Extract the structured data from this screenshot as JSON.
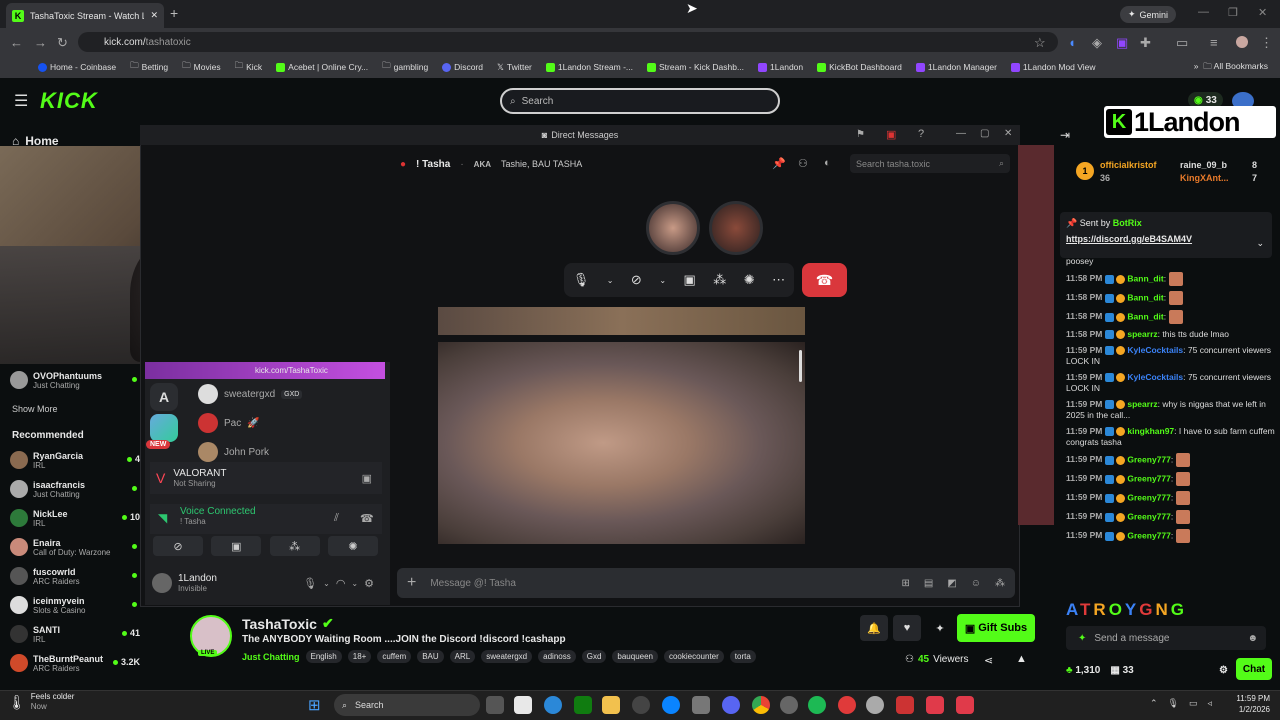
{
  "browser": {
    "tab_title": "TashaToxic Stream - Watch Live",
    "gemini": "Gemini",
    "url_host": "kick.com/",
    "url_path": "tashatoxic",
    "bookmarks": [
      "Home - Coinbase",
      "Betting",
      "Movies",
      "Kick",
      "Acebet | Online Cry...",
      "gambling",
      "Discord",
      "Twitter",
      "1Landon Stream -...",
      "Stream - Kick Dashb...",
      "1Landon",
      "KickBot Dashboard",
      "1Landon Manager",
      "1Landon Mod View"
    ],
    "all_bookmarks": "All Bookmarks"
  },
  "kick": {
    "search_placeholder": "Search",
    "home": "Home",
    "viewer_count": "33",
    "brand_name": "1Landon",
    "show_more": "Show More",
    "recommended": "Recommended",
    "following": [
      {
        "name": "OVOPhantuums",
        "sub": "Just Chatting",
        "count": ""
      }
    ],
    "recommended_list": [
      {
        "name": "RyanGarcia",
        "sub": "IRL",
        "count": "4",
        "color": "#8a6a50"
      },
      {
        "name": "isaacfrancis",
        "sub": "Just Chatting",
        "count": "",
        "color": "#aaa"
      },
      {
        "name": "NickLee",
        "sub": "IRL",
        "count": "10",
        "color": "#2d7a3a"
      },
      {
        "name": "Enaira",
        "sub": "Call of Duty: Warzone",
        "count": "",
        "color": "#c98a7a"
      },
      {
        "name": "fuscowrld",
        "sub": "ARC Raiders",
        "count": "",
        "color": "#555"
      },
      {
        "name": "iceinmyvein",
        "sub": "Slots & Casino",
        "count": "",
        "color": "#ddd"
      },
      {
        "name": "SANTI",
        "sub": "IRL",
        "count": "41",
        "color": "#333"
      },
      {
        "name": "TheBurntPeanut",
        "sub": "ARC Raiders",
        "count": "3.2K",
        "color": "#d04a2a"
      }
    ]
  },
  "discord": {
    "window_title": "Direct Messages",
    "dm_name": "! Tasha",
    "aka_label": "AKA",
    "aka_names": "Tashie, BAU TASHA",
    "search_placeholder": "Search tasha.toxic",
    "strip_link": "kick.com/TashaToxic",
    "new_badge": "NEW",
    "voice_users": [
      {
        "name": "sweatergxd",
        "tag": "GXD"
      },
      {
        "name": "Pac",
        "tag": ""
      },
      {
        "name": "John Pork",
        "tag": ""
      }
    ],
    "game": "VALORANT",
    "game_sub": "Not Sharing",
    "voice_connected": "Voice Connected",
    "voice_channel": "! Tasha",
    "user_name": "1Landon",
    "user_status": "Invisible",
    "message_placeholder": "Message @! Tasha"
  },
  "chat": {
    "leaders": [
      {
        "name": "officialkristof",
        "value": "36",
        "color": "#f5a623"
      },
      {
        "name": "raine_09_b",
        "value": "8",
        "color": "#ddd"
      },
      {
        "name": "KingXAnt...",
        "value": "7",
        "color": "#e87a2a"
      }
    ],
    "sent_by_label": "Sent by",
    "sent_by_name": "BotRix",
    "sent_by_link": "https://discord.gg/eB4SAM4V",
    "messages": [
      {
        "time": "",
        "user": "",
        "color": "#ddd",
        "text": "poosey"
      },
      {
        "time": "11:58 PM",
        "user": "Bann_dit",
        "color": "#53fc18",
        "text": ""
      },
      {
        "time": "11:58 PM",
        "user": "Bann_dit",
        "color": "#53fc18",
        "text": ""
      },
      {
        "time": "11:58 PM",
        "user": "Bann_dit",
        "color": "#53fc18",
        "text": ""
      },
      {
        "time": "11:58 PM",
        "user": "spearrz",
        "color": "#53fc18",
        "text": "this tts dude lmao"
      },
      {
        "time": "11:59 PM",
        "user": "KyleCocktails",
        "color": "#3b82f6",
        "text": "75 concurrent viewers LOCK IN"
      },
      {
        "time": "11:59 PM",
        "user": "KyleCocktails",
        "color": "#3b82f6",
        "text": "75 concurrent viewers LOCK IN"
      },
      {
        "time": "11:59 PM",
        "user": "spearrz",
        "color": "#53fc18",
        "text": "why is niggas that we left in 2025 in the call..."
      },
      {
        "time": "11:59 PM",
        "user": "kingkhan97",
        "color": "#53fc18",
        "text": "I have to sub farm cuffem congrats tasha"
      },
      {
        "time": "11:59 PM",
        "user": "Greeny777",
        "color": "#53fc18",
        "text": ""
      },
      {
        "time": "11:59 PM",
        "user": "Greeny777",
        "color": "#53fc18",
        "text": ""
      },
      {
        "time": "11:59 PM",
        "user": "Greeny777",
        "color": "#53fc18",
        "text": ""
      },
      {
        "time": "11:59 PM",
        "user": "Greeny777",
        "color": "#53fc18",
        "text": ""
      },
      {
        "time": "11:59 PM",
        "user": "Greeny777",
        "color": "#53fc18",
        "text": ""
      }
    ],
    "atroy": "ATROYGNG",
    "send_placeholder": "Send a message",
    "points": "1,310",
    "gift_count": "33",
    "chat_button": "Chat"
  },
  "stream": {
    "streamer": "TashaToxic",
    "live_label": "LIVE",
    "title": "The ANYBODY Waiting Room ....JOIN the Discord !discord !cashapp",
    "category": "Just Chatting",
    "tags": [
      "English",
      "18+",
      "cuffem",
      "BAU",
      "ARL",
      "sweatergxd",
      "adinoss",
      "Gxd",
      "bauqueen",
      "cookiecounter",
      "torta"
    ],
    "gift_subs": "Gift Subs",
    "viewers_num": "45",
    "viewers_label": "Viewers"
  },
  "taskbar": {
    "weather_title": "Feels colder",
    "weather_sub": "Now",
    "search": "Search",
    "time": "11:59 PM",
    "date": "1/2/2026"
  }
}
